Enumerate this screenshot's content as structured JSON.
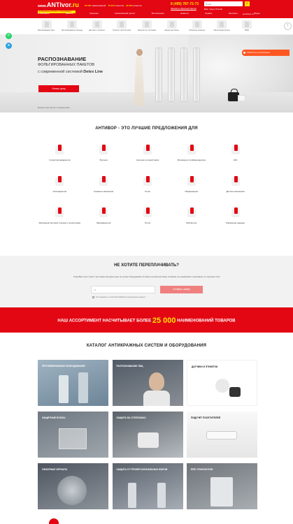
{
  "header": {
    "logo_main": "ANTIvor",
    "logo_prefix": "www.",
    "logo_suffix": ".ru",
    "logo_tagline": "антикражные системы и оборудование",
    "stats": [
      {
        "number": "25 000",
        "text": "наименований"
      },
      {
        "number": "75 000",
        "text": "клиентов"
      },
      {
        "number": "30 000",
        "text": "клиентов"
      }
    ],
    "phone": "8 (495) 787-72-73",
    "callback": "Заказать обратный звонок",
    "search_placeholder": "Поиск",
    "city": "Ваш город: Россия",
    "lang": "ac-Direct.ru",
    "nav": [
      "О компании",
      "Каталог",
      "Решения",
      "Комплексный проект",
      "Фотогалерея",
      "Новости",
      "Сервис",
      "Контакты",
      "Видео"
    ]
  },
  "categories": [
    "Распознавание фол...",
    "Противокражное оборудование",
    "Датчики и этикетки",
    "Подсчет посетителей",
    "Защита на стеллажах",
    "Защитные боксы",
    "Обзорные зеркала",
    "Металлодетекторы",
    "RFID"
  ],
  "hero": {
    "title1": "РАСПОЗНАВАНИЕ",
    "title2": "ФОЛЬГИРОВАННЫХ ПАКЕТОВ",
    "title3_prefix": "с современной системой",
    "title3_bold": "Detex Line",
    "button": "Узнать цену",
    "caption": "Магазин ООО \"Бутик\" в г.Москва 2024",
    "chat_badge": "Обратитесь за помощью!"
  },
  "offers": {
    "title": "АНТИВОР - ЭТО ЛУЧШИЕ ПРЕДЛОЖЕНИЯ ДЛЯ",
    "items": [
      "Супер/гипермаркетов",
      "Бутиков",
      "Салонов сотовой связи",
      "Магазинов стройматериалов",
      "АЗС",
      "Алкомаркетов",
      "Книжных магазинов",
      "Аптек",
      "Парфюмерии",
      "Детских магазинов",
      "Магазинов бытовой техники и электроники",
      "Минимаркетов",
      "Оптик",
      "Библиотек",
      "Магазинов одежды"
    ]
  },
  "overpay": {
    "title": "НЕ ХОТИТЕ ПЕРЕПЛАЧИВАТЬ?",
    "text": "Тогда Вам точно к нам! У нас самые выгодные цены на лучшее оборудование! Оставьте контактный номер телефона, мы перезвоним и расскажем, это хорошая стоит!",
    "phone_placeholder": "+7",
    "button": "Оставить заявку",
    "consent": "Я соглашаюсь с политикой обработки персональных данных"
  },
  "banner": {
    "prefix": "НАШ АССОРТИМЕНТ НАСЧИТЫВАЕТ БОЛЕЕ",
    "number": "25 000",
    "suffix": "НАИМЕНОВАНИЙ ТОВАРОВ"
  },
  "catalog": {
    "title": "КАТАЛОГ АНТИКРАЖНЫХ СИСТЕМ И ОБОРУДОВАНИЯ",
    "tiles": [
      "Противокражное оборудование",
      "Распознавание лиц",
      "Датчики и этикетки",
      "Защитные боксы",
      "Защита на стеллажах",
      "Подсчет посетителей",
      "Обзорные зеркала",
      "Защита от профессиональных воров",
      "RFID технологии"
    ]
  },
  "colors": {
    "brand_red": "#e30613",
    "brand_yellow": "#ffe200",
    "send_button": "#f08080"
  }
}
